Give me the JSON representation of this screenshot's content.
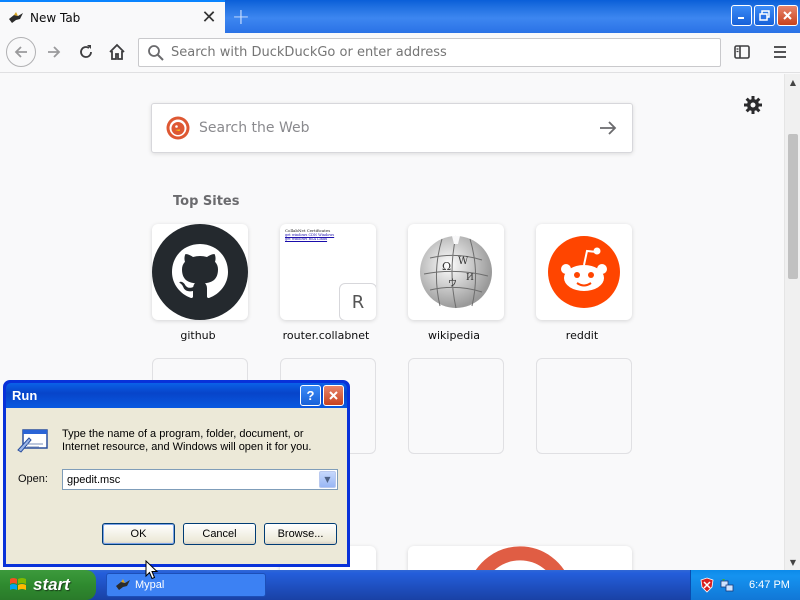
{
  "browser": {
    "tab": {
      "title": "New Tab",
      "close_icon": "close-icon"
    },
    "new_tab_icon": "plus-icon",
    "window_buttons": [
      "minimize",
      "restore",
      "close"
    ],
    "urlbar": {
      "placeholder": "Search with DuckDuckGo or enter address"
    }
  },
  "newtab": {
    "search": {
      "placeholder": "Search the Web"
    },
    "top_sites_title": "Top Sites",
    "sites": [
      {
        "label": "github",
        "icon": "github-icon"
      },
      {
        "label": "router.collabnet",
        "icon": "router-preview",
        "letter": "R",
        "preview": [
          "CollabNet Certificates",
          "get windows CDN Windows",
          "get windows RSA Linux"
        ]
      },
      {
        "label": "wikipedia",
        "icon": "wikipedia-icon"
      },
      {
        "label": "reddit",
        "icon": "reddit-icon"
      }
    ]
  },
  "run_dialog": {
    "title": "Run",
    "help_label": "?",
    "description": "Type the name of a program, folder, document, or Internet resource, and Windows will open it for you.",
    "open_label": "Open:",
    "open_value": "gpedit.msc",
    "ok_label": "OK",
    "cancel_label": "Cancel",
    "browse_label": "Browse..."
  },
  "taskbar": {
    "start_label": "start",
    "task_label": "Mypal",
    "clock": "6:47 PM"
  },
  "colors": {
    "accent": "#0a84ff",
    "xp_blue": "#245edb",
    "start_green": "#2f8a2f"
  }
}
